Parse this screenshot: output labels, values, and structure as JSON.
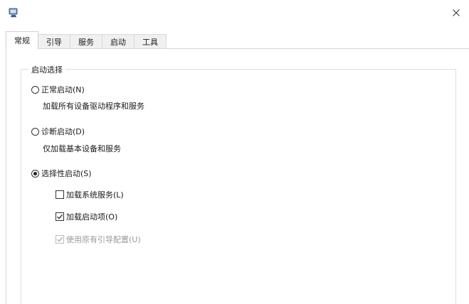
{
  "window": {
    "icon": "msconfig-app-icon",
    "close_icon": "close-icon"
  },
  "tabs": [
    {
      "label": "常规",
      "active": true
    },
    {
      "label": "引导",
      "active": false
    },
    {
      "label": "服务",
      "active": false
    },
    {
      "label": "启动",
      "active": false
    },
    {
      "label": "工具",
      "active": false
    }
  ],
  "startup_selection": {
    "group_label": "启动选择",
    "options": [
      {
        "label": "正常启动(N)",
        "description": "加载所有设备驱动程序和服务",
        "selected": false
      },
      {
        "label": "诊断启动(D)",
        "description": "仅加载基本设备和服务",
        "selected": false
      },
      {
        "label": "选择性启动(S)",
        "selected": true
      }
    ],
    "selective_options": [
      {
        "label": "加载系统服务(L)",
        "checked": false,
        "enabled": true
      },
      {
        "label": "加载启动项(O)",
        "checked": true,
        "enabled": true
      },
      {
        "label": "使用原有引导配置(U)",
        "checked": true,
        "enabled": false
      }
    ]
  }
}
